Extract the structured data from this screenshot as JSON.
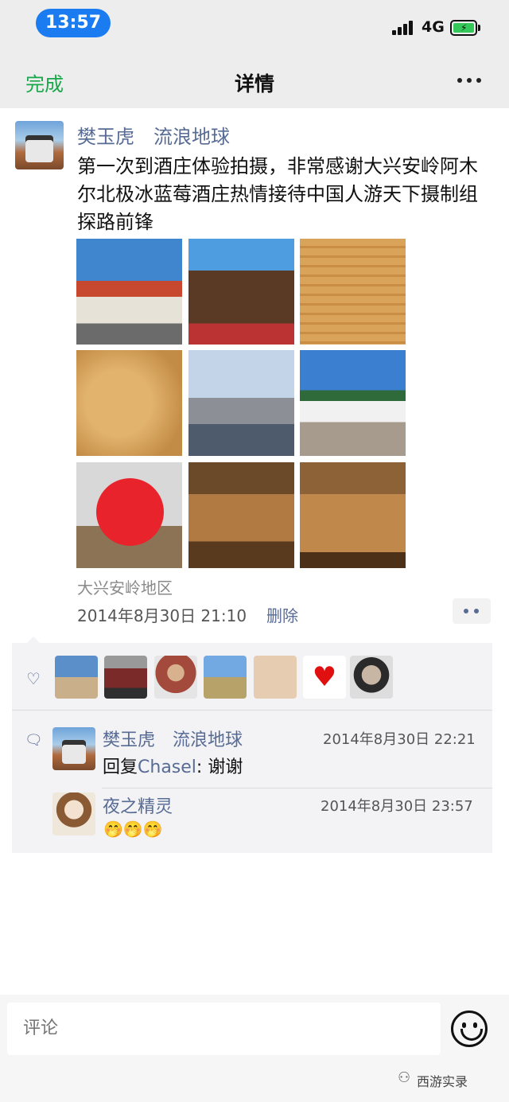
{
  "status_bar": {
    "time": "13:57",
    "network": "4G"
  },
  "nav": {
    "done_label": "完成",
    "title": "详情"
  },
  "post": {
    "author": "樊玉虎　流浪地球",
    "text": "第一次到酒庄体验拍摄，非常感谢大兴安岭阿木尔北极冰蓝莓酒庄热情接待中国人游天下摄制组探路前锋",
    "location": "大兴安岭地区",
    "time": "2014年8月30日 21:10",
    "delete_label": "删除"
  },
  "comments": [
    {
      "name": "樊玉虎　流浪地球",
      "date": "2014年8月30日 22:21",
      "reply_prefix": "回复",
      "reply_to": "Chasel",
      "text": ": 谢谢"
    },
    {
      "name": "夜之精灵",
      "date": "2014年8月30日 23:57",
      "text": "🤭🤭🤭"
    }
  ],
  "comment_bar": {
    "placeholder": "评论"
  },
  "watermark": "西游实录"
}
